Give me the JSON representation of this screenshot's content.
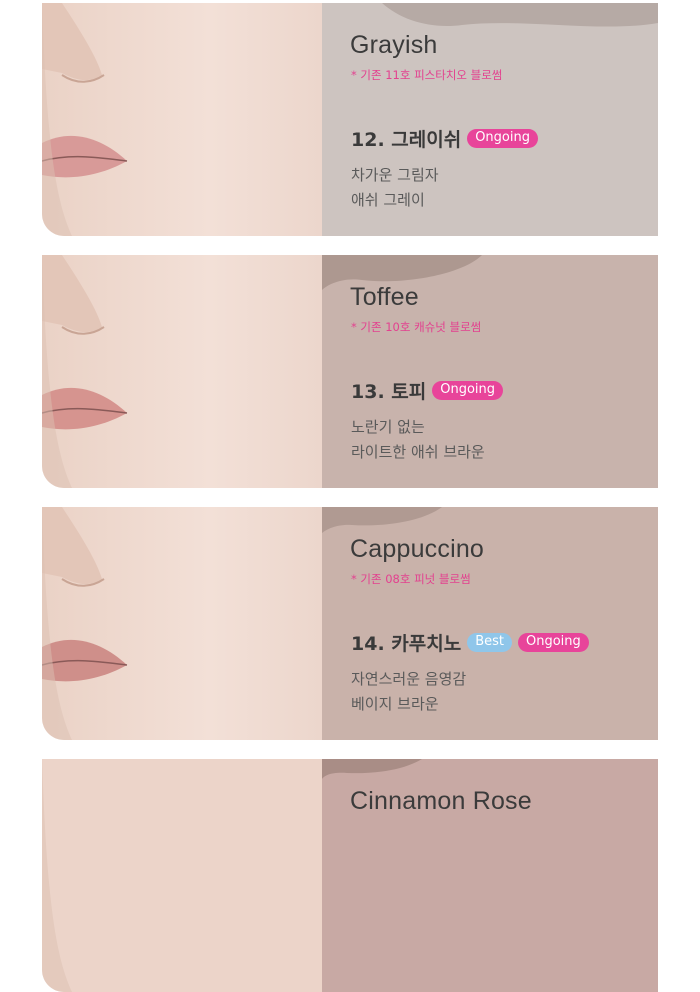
{
  "colors": {
    "ongoing_badge": "#e8449a",
    "best_badge": "#8fc6ea",
    "note_pink": "#e3418f"
  },
  "cards": [
    {
      "title": "Grayish",
      "note": "* 기존 11호 피스타치오 블로썸",
      "shade": "12. 그레이쉬",
      "badges": [
        "Ongoing"
      ],
      "desc": [
        "차가운 그림자",
        "애쉬 그레이"
      ],
      "panel_color": "#cdc4c0"
    },
    {
      "title": "Toffee",
      "note": "* 기존 10호 캐슈넛 블로썸",
      "shade": "13. 토피",
      "badges": [
        "Ongoing"
      ],
      "desc": [
        "노란기 없는",
        "라이트한 애쉬 브라운"
      ],
      "panel_color": "#c8b3ac"
    },
    {
      "title": "Cappuccino",
      "note": "* 기존 08호 피넛 블로썸",
      "shade": "14. 카푸치노",
      "badges": [
        "Best",
        "Ongoing"
      ],
      "desc": [
        "자연스러운 음영감",
        "베이지 브라운"
      ],
      "panel_color": "#c9b2aa"
    },
    {
      "title": "Cinnamon Rose",
      "panel_color": "#c8a9a4"
    }
  ]
}
